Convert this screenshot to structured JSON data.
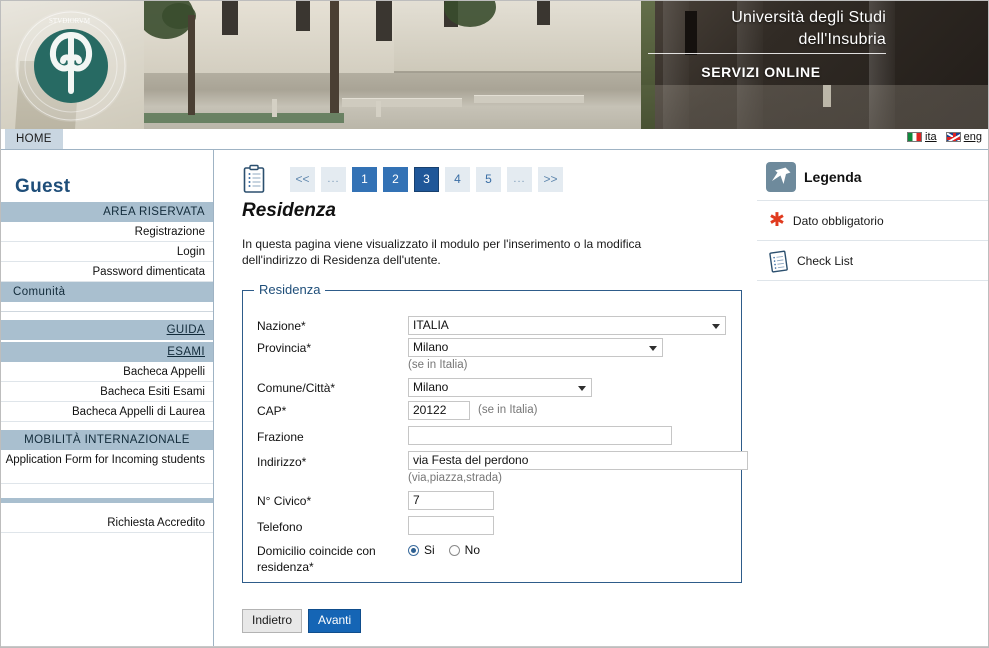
{
  "header": {
    "university_line1": "Università degli Studi",
    "university_line2": "dell'Insubria",
    "service_label": "SERVIZI ONLINE",
    "logo_icon": "insubria-seal-icon"
  },
  "menubar": {
    "home_label": "HOME",
    "languages": [
      {
        "code": "ita",
        "label": "ita",
        "flag_icon": "flag-italy-icon"
      },
      {
        "code": "eng",
        "label": "eng",
        "flag_icon": "flag-uk-icon"
      }
    ]
  },
  "sidebar": {
    "user_label": "Guest",
    "sections": [
      {
        "heading": "AREA RISERVATA",
        "items": [
          "Registrazione",
          "Login",
          "Password dimenticata"
        ]
      }
    ],
    "community_label": "Comunità",
    "guida_label": "GUIDA",
    "esami_label": "ESAMI",
    "esami_items": [
      "Bacheca Appelli",
      "Bacheca Esiti Esami",
      "Bacheca Appelli di Laurea"
    ],
    "mobility_label": "MOBILITÀ INTERNAZIONALE",
    "mobility_items": [
      "Application Form for Incoming students"
    ],
    "accredito_label": "Richiesta Accredito"
  },
  "pager": {
    "checklist_icon": "checklist-clipboard-icon",
    "first_label": "<<",
    "ellipsis_left": "...",
    "pages": [
      {
        "label": "1",
        "state": "done"
      },
      {
        "label": "2",
        "state": "done"
      },
      {
        "label": "3",
        "state": "current"
      },
      {
        "label": "4",
        "state": "todo"
      },
      {
        "label": "5",
        "state": "todo"
      }
    ],
    "ellipsis_right": "...",
    "last_label": ">>"
  },
  "main": {
    "title": "Residenza",
    "description": "In questa pagina viene visualizzato il modulo per l'inserimento o la modifica dell'indirizzo di Residenza dell'utente.",
    "fieldset_legend": "Residenza",
    "fields": {
      "nazione": {
        "label": "Nazione*",
        "value": "ITALIA",
        "type": "select"
      },
      "provincia": {
        "label": "Provincia*",
        "value": "Milano",
        "type": "select",
        "hint": "(se in Italia)"
      },
      "comune": {
        "label": "Comune/Città*",
        "value": "Milano",
        "type": "select"
      },
      "cap": {
        "label": "CAP*",
        "value": "20122",
        "type": "text",
        "hint": "(se in Italia)"
      },
      "frazione": {
        "label": "Frazione",
        "value": "",
        "type": "text"
      },
      "indirizzo": {
        "label": "Indirizzo*",
        "value": "via Festa del perdono",
        "type": "text",
        "hint": "(via,piazza,strada)"
      },
      "civico": {
        "label": "N° Civico*",
        "value": "7",
        "type": "text"
      },
      "telefono": {
        "label": "Telefono",
        "value": "",
        "type": "text"
      },
      "domicilio": {
        "label": "Domicilio coincide con residenza*",
        "options": [
          {
            "label": "Si",
            "selected": true
          },
          {
            "label": "No",
            "selected": false
          }
        ]
      }
    },
    "buttons": {
      "back_label": "Indietro",
      "next_label": "Avanti"
    }
  },
  "right_panel": {
    "title": "Legenda",
    "title_icon": "pushpin-icon",
    "rows": [
      {
        "label": "Dato obbligatorio",
        "icon": "red-asterisk-icon"
      },
      {
        "label": "Check List",
        "icon": "checklist-clipboard-icon"
      }
    ]
  },
  "colors": {
    "brand_dark_blue": "#1f4e79",
    "sidebar_heading": "#a9bfcf",
    "pager_done": "#3372b5",
    "pager_current": "#1f5799",
    "pager_todo": "#e4ebf1",
    "fieldset_border": "#2e5c8a",
    "next_button": "#1565b5",
    "required_star": "#e03a1e",
    "logo_green": "#276a63"
  }
}
